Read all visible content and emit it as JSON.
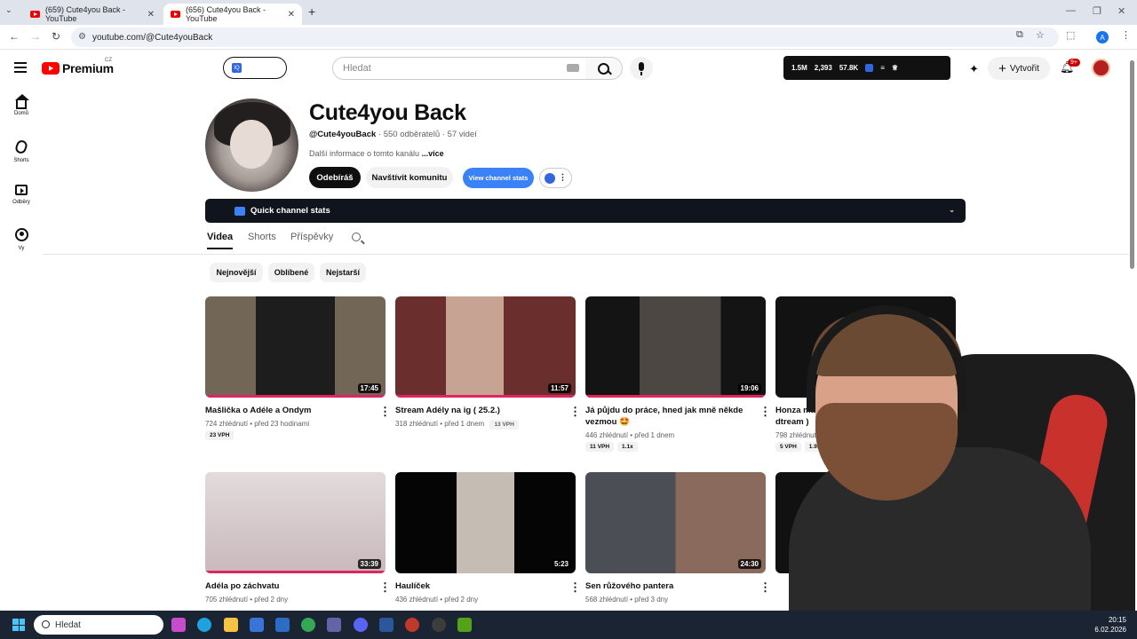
{
  "browser": {
    "tabs": [
      {
        "title": "(659) Cute4you Back - YouTube",
        "active": false
      },
      {
        "title": "(656) Cute4you Back - YouTube",
        "active": true
      }
    ],
    "url": "youtube.com/@Cute4youBack",
    "profile_initial": "A"
  },
  "header": {
    "logo_word": "Premium",
    "country": "CZ",
    "search_placeholder": "Hledat",
    "stats": {
      "views": "1.5M",
      "watching": "2,393",
      "subs": "57.8K"
    },
    "create_label": "Vytvořit",
    "notif_badge": "9+"
  },
  "sidebar": {
    "items": [
      {
        "label": "Domů",
        "icon": "home-icon"
      },
      {
        "label": "Shorts",
        "icon": "shorts-icon"
      },
      {
        "label": "Odběry",
        "icon": "subscriptions-icon"
      },
      {
        "label": "Vy",
        "icon": "you-icon"
      }
    ]
  },
  "channel": {
    "name": "Cute4you Back",
    "handle": "@Cute4youBack",
    "subscribers": "550 odběratelů",
    "videos": "57 videí",
    "description": "Další informace o tomto kanálu",
    "more": "...více",
    "subscribed_label": "Odebíráš",
    "community_label": "Navštívit komunitu",
    "stats_label": "View channel stats",
    "quick_stats_label": "Quick channel stats"
  },
  "tabs": [
    "Videa",
    "Shorts",
    "Příspěvky"
  ],
  "chips": [
    "Nejnovější",
    "Oblíbené",
    "Nejstarší"
  ],
  "videos": [
    {
      "title": "Mašlička o Adéle a Ondym",
      "meta": "724 zhlédnutí • před 23 hodinami",
      "duration": "17:45",
      "tags": [
        "23 VPH"
      ]
    },
    {
      "title": "Stream Adély na ig ( 25.2.)",
      "meta": "318 zhlédnutí • před 1 dnem",
      "duration": "11:57",
      "tags": [
        "13 VPH"
      ]
    },
    {
      "title": "Já půjdu do práce, hned jak mně někde vezmou 🤩",
      "meta": "446 zhlédnutí • před 1 dnem",
      "duration": "19:06",
      "tags": [
        "11 VPH",
        "1.1x"
      ]
    },
    {
      "title": "Honza má",
      "title2": "dtream )",
      "meta": "798 zhlédnutí •",
      "duration": "",
      "tags": [
        "5 VPH",
        "1.9x"
      ]
    },
    {
      "title": "Adéla po záchvatu",
      "meta": "705 zhlédnutí • před 2 dny",
      "duration": "33:39",
      "tags": []
    },
    {
      "title": "Haulíček",
      "meta": "436 zhlédnutí • před 2 dny",
      "duration": "5:23",
      "tags": []
    },
    {
      "title": "Sen růžového pantera",
      "meta": "568 zhlédnutí • před 3 dny",
      "duration": "24:30",
      "tags": []
    }
  ],
  "taskbar": {
    "search_label": "Hledat",
    "time": "20:15",
    "date": "6.02.2026"
  }
}
